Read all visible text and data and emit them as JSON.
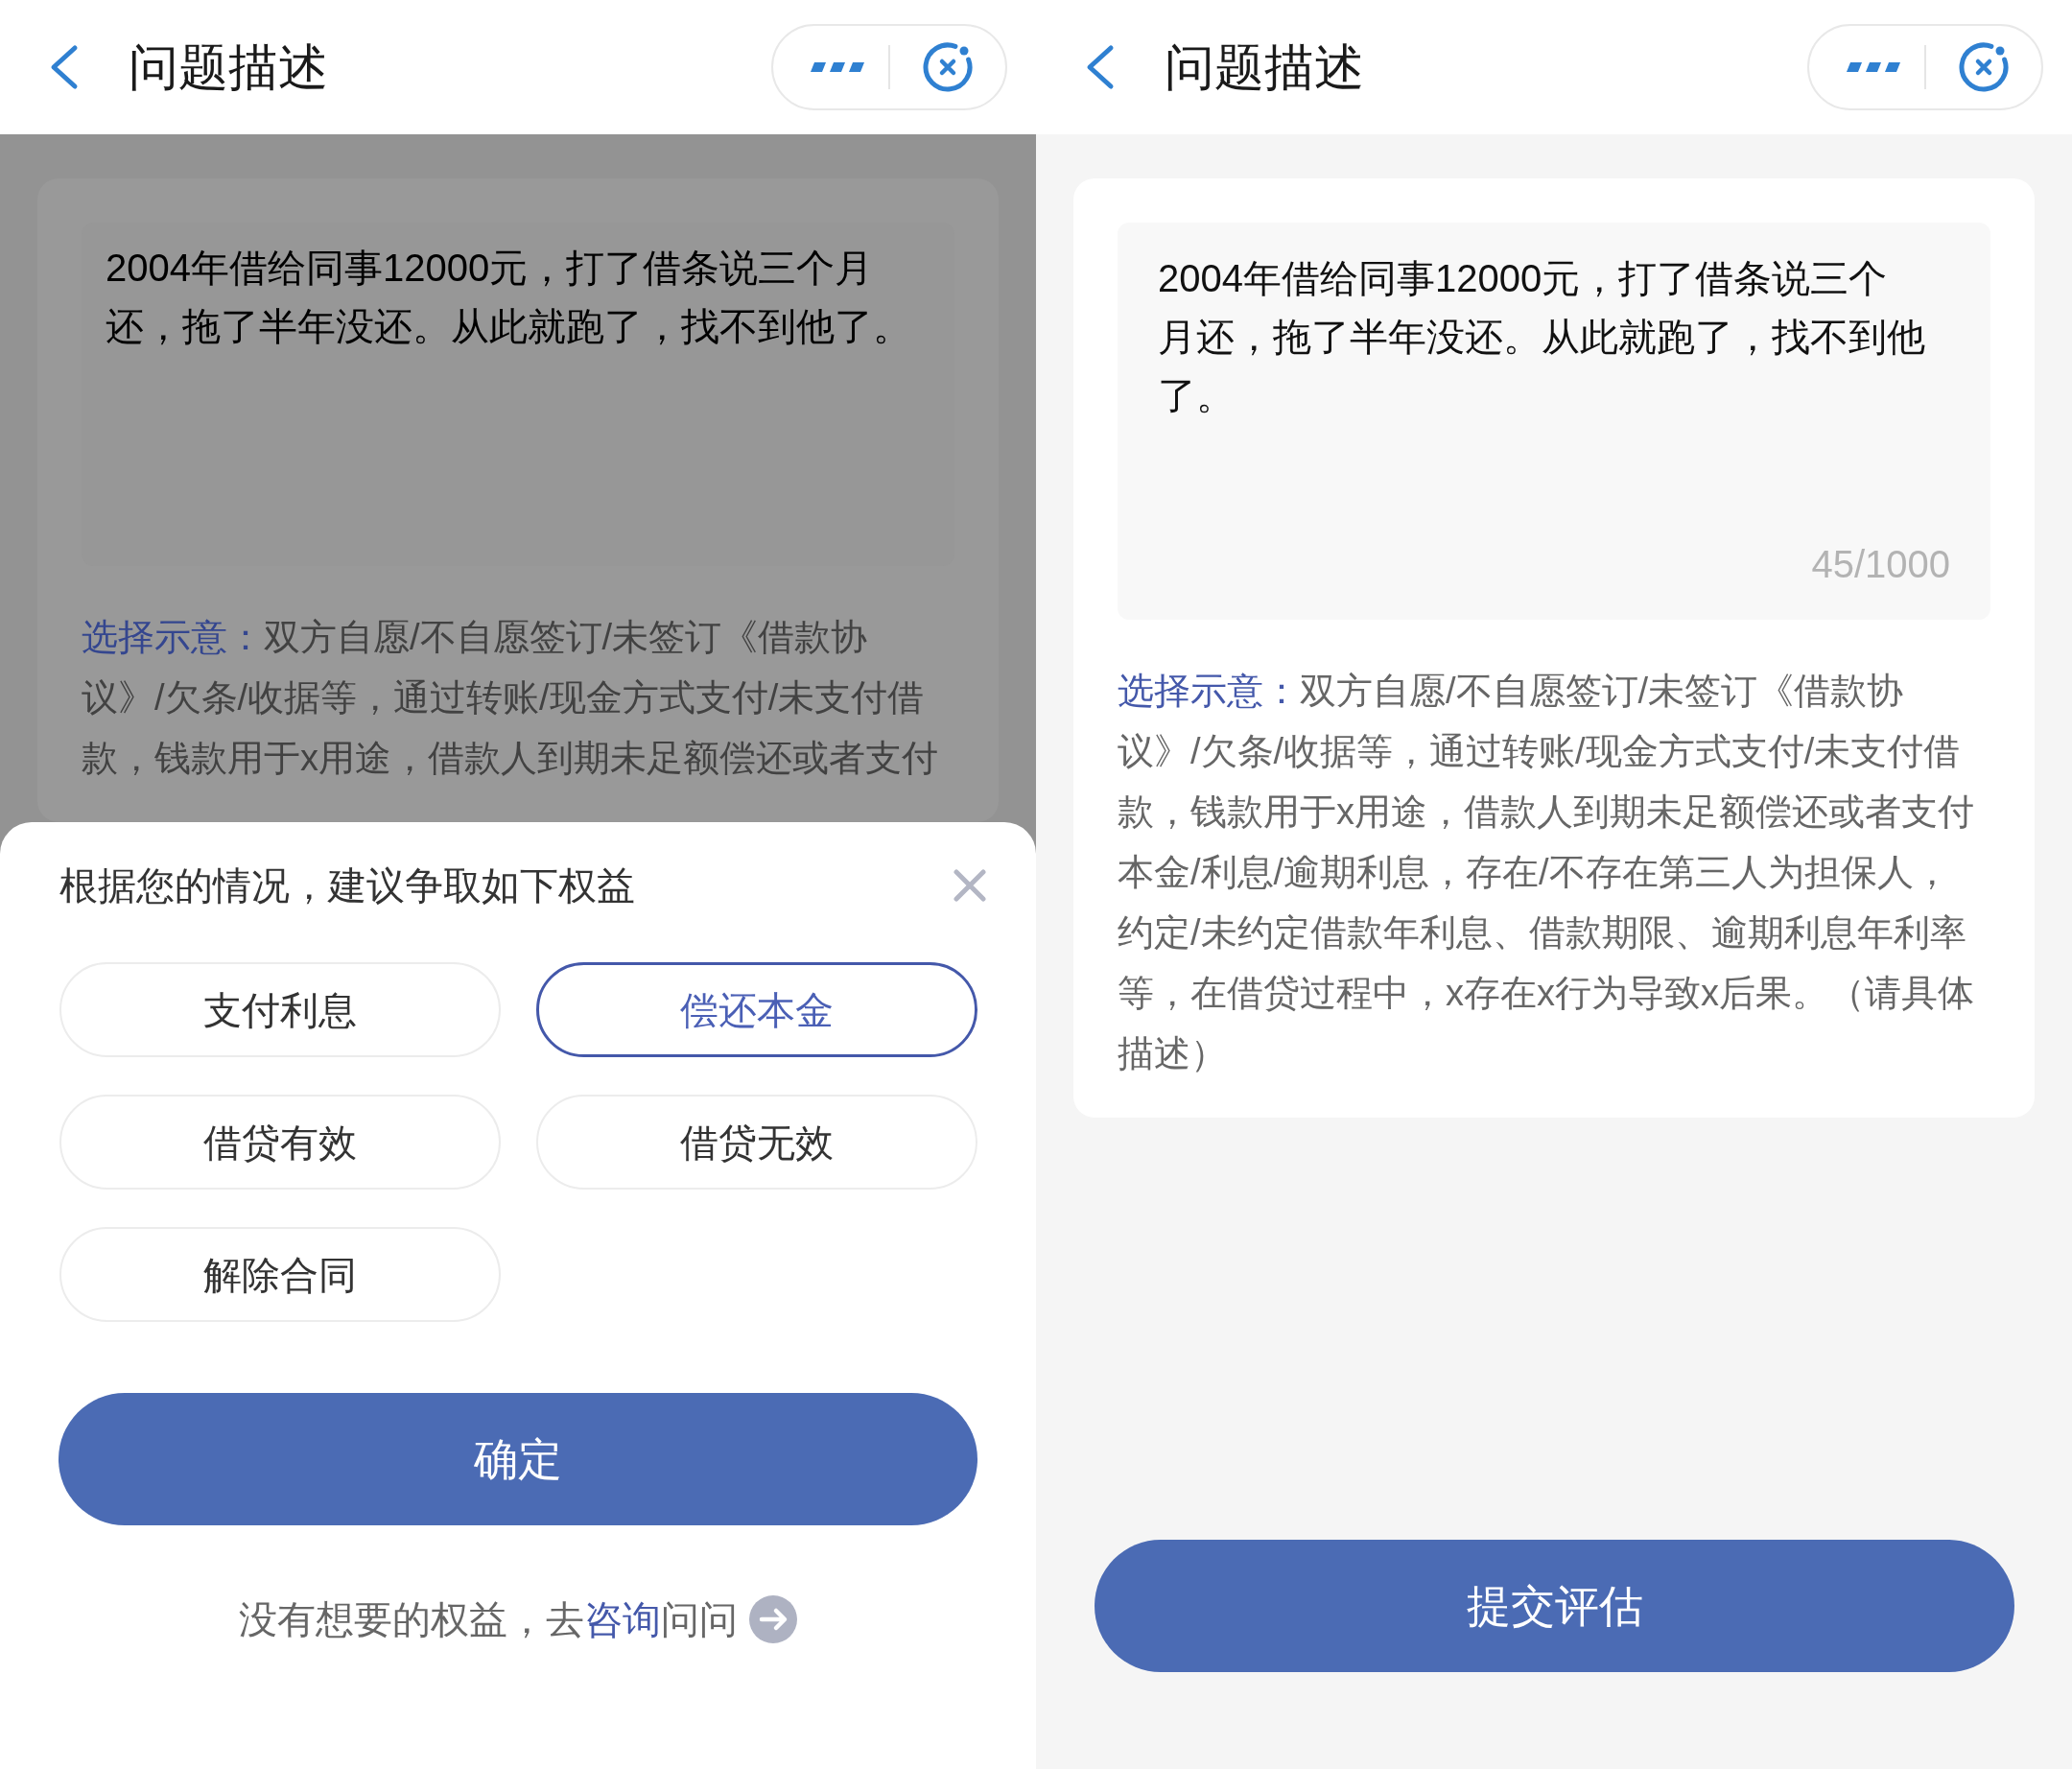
{
  "screens": [
    {
      "dimmed": true,
      "header": {
        "title": "问题描述"
      },
      "description": {
        "text": "2004年借给同事12000元，打了借条说三个月还，拖了半年没还。从此就跑了，找不到他了。"
      },
      "hint": {
        "label": "选择示意：",
        "text": "双方自愿/不自愿签订/未签订《借款协议》/欠条/收据等，通过转账/现金方式支付/未支付借款，钱款用于x用途，借款人到期未足额偿还或者支付"
      },
      "sheet": {
        "title": "根据您的情况，建议争取如下权益",
        "options": [
          {
            "label": "支付利息",
            "selected": false
          },
          {
            "label": "偿还本金",
            "selected": true
          },
          {
            "label": "借贷有效",
            "selected": false
          },
          {
            "label": "借贷无效",
            "selected": false
          },
          {
            "label": "解除合同",
            "selected": false
          }
        ],
        "confirm": "确定",
        "footer": {
          "before": "没有想要的权益，去",
          "link": "咨询",
          "after": "问问"
        }
      }
    },
    {
      "dimmed": false,
      "header": {
        "title": "问题描述"
      },
      "description": {
        "text": "2004年借给同事12000元，打了借条说三个月还，拖了半年没还。从此就跑了，找不到他了。",
        "counter": "45/1000"
      },
      "hint": {
        "label": "选择示意：",
        "text": "双方自愿/不自愿签订/未签订《借款协议》/欠条/收据等，通过转账/现金方式支付/未支付借款，钱款用于x用途，借款人到期未足额偿还或者支付本金/利息/逾期利息，存在/不存在第三人为担保人，约定/未约定借款年利息、借款期限、逾期利息年利率等，在借贷过程中，x存在x行为导致x后果。（请具体描述）"
      },
      "submit": "提交评估"
    }
  ]
}
